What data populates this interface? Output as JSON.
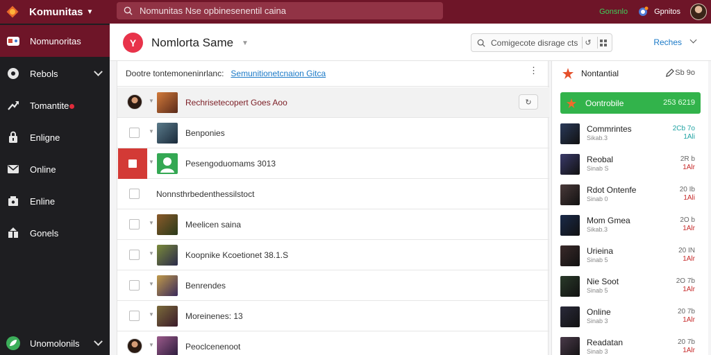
{
  "app": {
    "name": "Komunitas",
    "search_placeholder": "Nomunitas Nse opbinesenentil caina",
    "status_text": "Gonsnlo",
    "user_name": "Gpnitos"
  },
  "sidebar": {
    "items": [
      {
        "label": "Nomunoritas",
        "icon": "controller-icon",
        "active": true
      },
      {
        "label": "Rebols",
        "icon": "disc-icon",
        "has_chevron": true
      },
      {
        "label": "Tomantite",
        "icon": "trending-icon",
        "badge": true
      },
      {
        "label": "Enligne",
        "icon": "lock-icon"
      },
      {
        "label": "Online",
        "icon": "envelope-icon"
      },
      {
        "label": "Enline",
        "icon": "package-icon"
      },
      {
        "label": "Gonels",
        "icon": "puzzle-icon"
      }
    ],
    "footer": {
      "label": "Unomolonils",
      "icon": "leaf-icon"
    }
  },
  "header": {
    "title": "Nomlorta Same",
    "search_placeholder": "Comigecote disrage cts",
    "right_label": "Reches"
  },
  "list": {
    "head_text": "Dootre tontemoneninrlanc:",
    "head_link": "Semunitionetcnaion Gitca",
    "rows": [
      {
        "label": "Rechrisetecopert Goes Aoo",
        "avatar": true,
        "dark": true,
        "button": "G",
        "thumb_color": "#b85a2a"
      },
      {
        "label": "Benponies",
        "thumb_color": "#3a4a5a"
      },
      {
        "label": "Pesengoduomams 3013",
        "selected": true,
        "thumb_color": "#34a853"
      },
      {
        "label": "Nonnsthrbedenthessilstoct",
        "no_thumb": true
      },
      {
        "label": "Meelicen saina",
        "thumb_color": "#6a4a2a"
      },
      {
        "label": "Koopnike Kcoetionet 38.1.S",
        "thumb_color": "#4a5a3a"
      },
      {
        "label": "Benrendes",
        "thumb_color": "#7a6a3a"
      },
      {
        "label": "Moreinenes: 13",
        "thumb_color": "#5a4a3a"
      },
      {
        "label": "Peoclcenenoot",
        "avatar": true,
        "thumb_color": "#6a3a5a"
      }
    ]
  },
  "right_panel": {
    "title": "Nontantial",
    "count": "Sb 9o",
    "highlight": {
      "label": "Oontrobile",
      "value": "253 6219"
    },
    "items": [
      {
        "name": "Commrintes",
        "sub": "Sikab.3",
        "v1": "2Cb 7o",
        "v2": "1Ali",
        "teal": true,
        "color": "#2a3a5a"
      },
      {
        "name": "Reobal",
        "sub": "Sinab S",
        "v1": "2R b",
        "v2": "1Alr",
        "teal": false,
        "color": "#3a3a6a"
      },
      {
        "name": "Rdot Ontenfe",
        "sub": "Sinab 0",
        "v1": "20 Ib",
        "v2": "1Ali",
        "teal": false,
        "color": "#4a3a3a"
      },
      {
        "name": "Mom Gmea",
        "sub": "Sikab.3",
        "v1": "2O b",
        "v2": "1Alr",
        "teal": false,
        "color": "#1a2a4a"
      },
      {
        "name": "Urieina",
        "sub": "Sinab 5",
        "v1": "20 IN",
        "v2": "1Alr",
        "teal": false,
        "color": "#3a2a2a"
      },
      {
        "name": "Nie Soot",
        "sub": "Sinab 5",
        "v1": "2O 7b",
        "v2": "1Alr",
        "teal": false,
        "color": "#2a3a2a"
      },
      {
        "name": "Online",
        "sub": "Sinab 3",
        "v1": "20 7b",
        "v2": "1Alr",
        "teal": false,
        "color": "#2a2a3a"
      },
      {
        "name": "Readatan",
        "sub": "Sinab 3",
        "v1": "20 7b",
        "v2": "1Alr",
        "teal": false,
        "color": "#4a3a4a"
      }
    ]
  },
  "colors": {
    "brand": "#6e1528",
    "sidebar_bg": "#1e1e21",
    "accent_green": "#32b34b",
    "link_blue": "#1a79c7",
    "danger": "#d33a36"
  }
}
